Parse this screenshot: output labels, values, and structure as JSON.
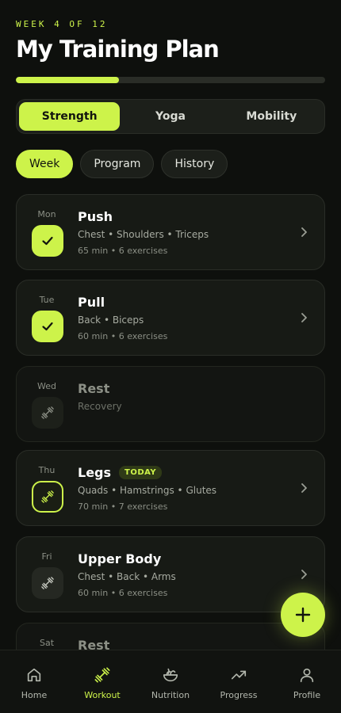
{
  "header": {
    "week_label": "WEEK 4 OF 12",
    "title": "My Training Plan",
    "progress_fraction": 0.333
  },
  "segments": [
    {
      "label": "Strength",
      "active": true
    },
    {
      "label": "Yoga",
      "active": false
    },
    {
      "label": "Mobility",
      "active": false
    }
  ],
  "chips": [
    {
      "label": "Week",
      "active": true
    },
    {
      "label": "Program",
      "active": false
    },
    {
      "label": "History",
      "active": false
    }
  ],
  "workouts": [
    {
      "day": "Mon",
      "name": "Push",
      "muscles": "Chest • Shoulders • Triceps",
      "meta": "65 min • 6 exercises",
      "status": "done",
      "icon": "check-icon"
    },
    {
      "day": "Tue",
      "name": "Pull",
      "muscles": "Back • Biceps",
      "meta": "60 min • 6 exercises",
      "status": "done",
      "icon": "check-icon"
    },
    {
      "day": "Wed",
      "name": "Rest",
      "muscles": "Recovery",
      "meta": "",
      "status": "rest",
      "icon": "dumbbell-icon"
    },
    {
      "day": "Thu",
      "name": "Legs",
      "tag": "TODAY",
      "muscles": "Quads • Hamstrings • Glutes",
      "meta": "70 min • 7 exercises",
      "status": "today",
      "icon": "dumbbell-icon"
    },
    {
      "day": "Fri",
      "name": "Upper Body",
      "muscles": "Chest • Back • Arms",
      "meta": "60 min • 6 exercises",
      "status": "pending",
      "icon": "dumbbell-icon"
    },
    {
      "day": "Sat",
      "name": "Rest",
      "muscles": "",
      "meta": "",
      "status": "rest",
      "icon": "dumbbell-icon"
    }
  ],
  "tabbar": [
    {
      "label": "Home",
      "icon": "home-icon",
      "active": false
    },
    {
      "label": "Workout",
      "icon": "dumbbell-icon",
      "active": true
    },
    {
      "label": "Nutrition",
      "icon": "salad-bowl-icon",
      "active": false
    },
    {
      "label": "Progress",
      "icon": "trend-up-icon",
      "active": false
    },
    {
      "label": "Profile",
      "icon": "user-icon",
      "active": false
    }
  ],
  "colors": {
    "accent": "#cdf34a",
    "background": "#0e100d",
    "card": "#171a15"
  }
}
